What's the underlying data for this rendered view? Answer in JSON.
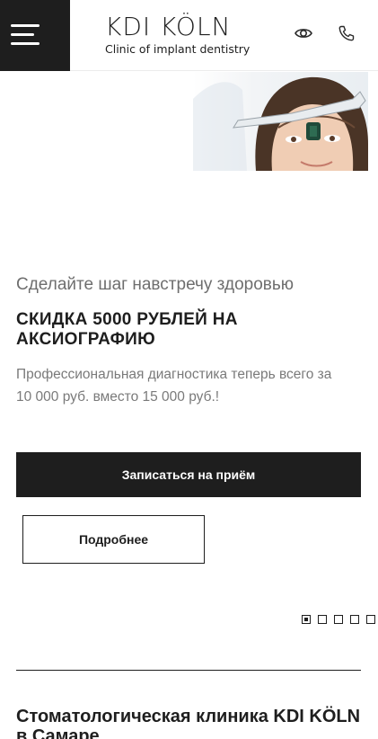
{
  "header": {
    "logo_title": "KDI KÖLN",
    "logo_subtitle": "Clinic of implant dentistry",
    "menu_icon": "hamburger-menu-icon",
    "accessibility_icon": "eye-icon",
    "phone_icon": "phone-icon"
  },
  "hero": {
    "image": "woman-with-axiograph-device",
    "tagline": "Сделайте шаг навстречу здоровью",
    "title": "СКИДКА 5000 РУБЛЕЙ НА АКСИОГРАФИЮ",
    "text": "Профессиональная диагностика теперь всего за 10 000 руб. вместо 15 000 руб.!",
    "primary_button": "Записаться на приём",
    "secondary_button": "Подробнее"
  },
  "slider": {
    "total": 5,
    "active": 1
  },
  "section": {
    "title": "Стоматологическая клиника KDI KÖLN в Самаре"
  },
  "colors": {
    "dark": "#1e1e1e",
    "muted_text": "#7a7a7a",
    "background": "#ffffff"
  }
}
